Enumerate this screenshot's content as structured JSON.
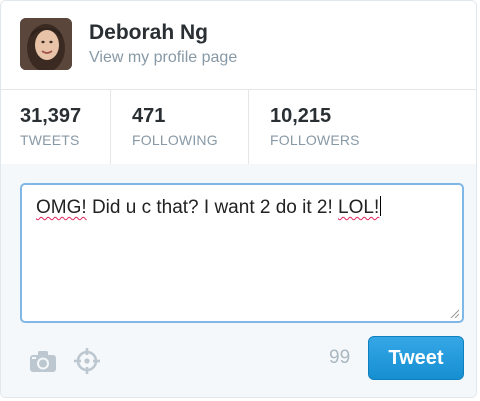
{
  "profile": {
    "name": "Deborah Ng",
    "link_text": "View my profile page"
  },
  "stats": [
    {
      "value": "31,397",
      "label": "TWEETS"
    },
    {
      "value": "471",
      "label": "FOLLOWING"
    },
    {
      "value": "10,215",
      "label": "FOLLOWERS"
    }
  ],
  "composer": {
    "words": [
      "OMG!",
      " Did u c that? I want 2 do it 2! ",
      "LOL!"
    ],
    "char_counter": "99",
    "tweet_button_label": "Tweet"
  },
  "icons": {
    "photo": "camera-icon",
    "location": "location-crosshair-icon"
  },
  "colors": {
    "accent": "#1d96d8",
    "muted": "#8899a6",
    "input_border": "#7fb8e6"
  }
}
